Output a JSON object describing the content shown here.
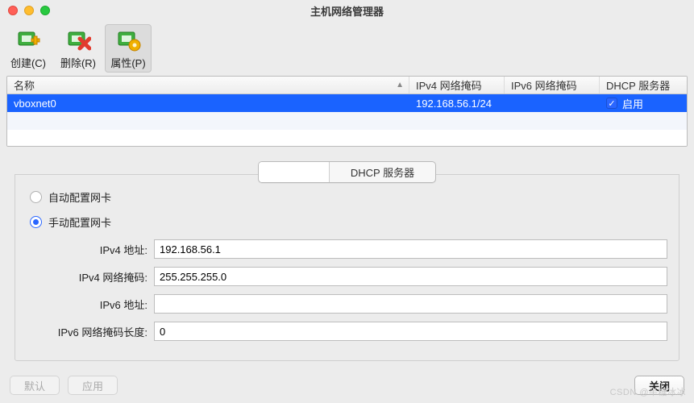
{
  "window": {
    "title": "主机网络管理器"
  },
  "toolbar": {
    "create": "创建(C)",
    "delete": "删除(R)",
    "props": "属性(P)"
  },
  "columns": {
    "name": "名称",
    "v4mask": "IPv4 网络掩码",
    "v6mask": "IPv6 网络掩码",
    "dhcp": "DHCP 服务器"
  },
  "rows": [
    {
      "name": "vboxnet0",
      "v4": "192.168.56.1/24",
      "v6": "",
      "dhcp_enabled": true,
      "dhcp_label": "启用"
    }
  ],
  "tabs": {
    "adapter_blank": "",
    "dhcp": "DHCP 服务器"
  },
  "radios": {
    "auto": "自动配置网卡",
    "manual": "手动配置网卡",
    "selected": "manual"
  },
  "form": {
    "ipv4_addr_label": "IPv4 地址:",
    "ipv4_addr_value": "192.168.56.1",
    "ipv4_mask_label": "IPv4 网络掩码:",
    "ipv4_mask_value": "255.255.255.0",
    "ipv6_addr_label": "IPv6 地址:",
    "ipv6_addr_value": "",
    "ipv6_len_label": "IPv6 网络掩码长度:",
    "ipv6_len_value": "0"
  },
  "buttons": {
    "defaults": "默认",
    "apply": "应用",
    "close": "关闭"
  },
  "watermark": "CSDN @半糖冰冰"
}
